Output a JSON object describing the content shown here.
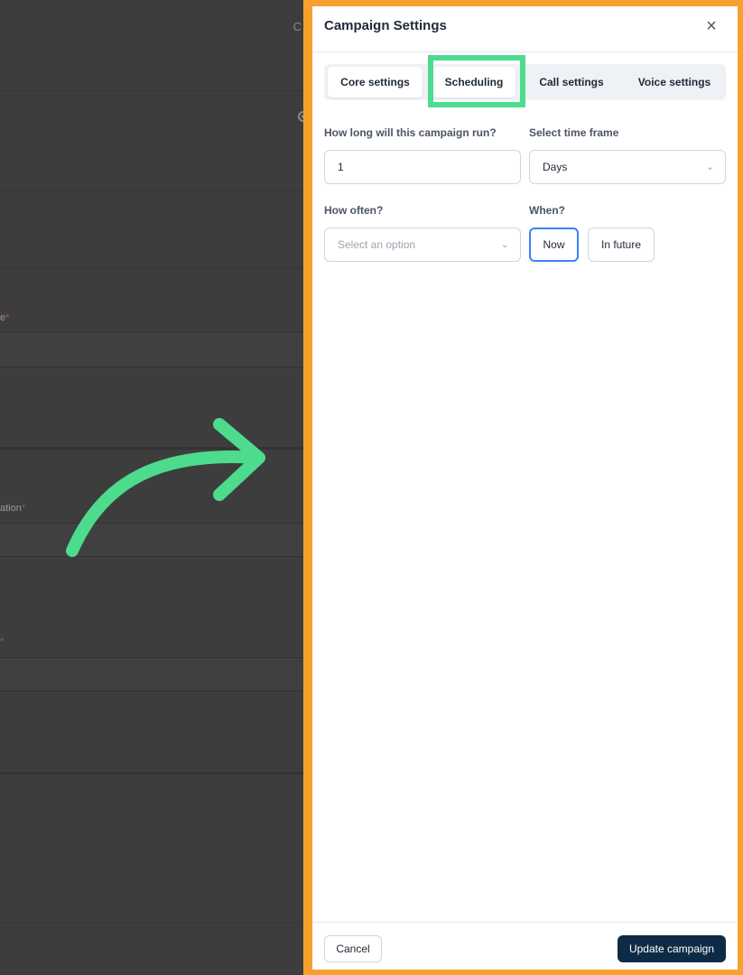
{
  "background_page": {
    "labels": [
      {
        "text": "e",
        "required": "*"
      },
      {
        "text": "ation",
        "required": "*"
      },
      {
        "text": "",
        "required": "*"
      }
    ],
    "peek_char": "C"
  },
  "drawer": {
    "title": "Campaign Settings",
    "close_icon": "×",
    "tabs": [
      {
        "label": "Core settings"
      },
      {
        "label": "Scheduling",
        "active": true
      },
      {
        "label": "Call settings"
      },
      {
        "label": "Voice settings"
      }
    ],
    "duration": {
      "label": "How long will this campaign run?",
      "value": "1"
    },
    "time_frame": {
      "label": "Select time frame",
      "value": "Days"
    },
    "frequency": {
      "label": "How often?",
      "placeholder": "Select an option"
    },
    "when": {
      "label": "When?",
      "options": [
        "Now",
        "In future"
      ],
      "selected": "Now"
    },
    "footer": {
      "cancel_label": "Cancel",
      "update_label": "Update campaign"
    }
  },
  "colors": {
    "frame": "#f6a02d",
    "highlight": "#4ddb8d",
    "primary_button": "#0d2b45",
    "selected_border": "#3b82f6"
  }
}
